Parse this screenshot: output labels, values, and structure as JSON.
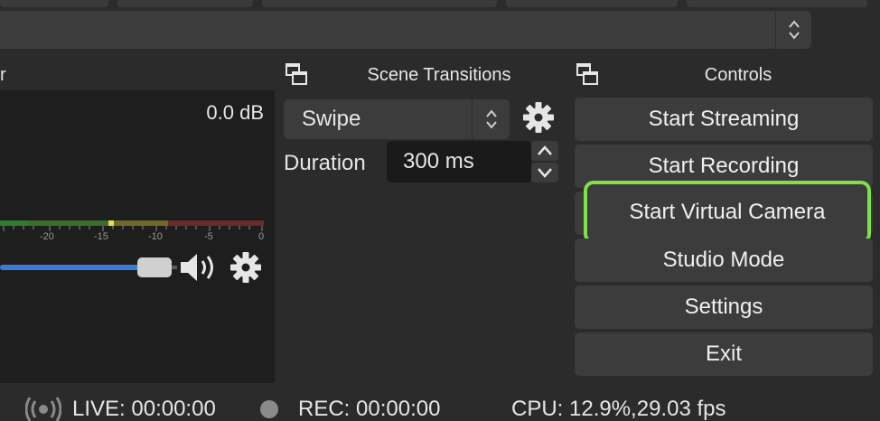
{
  "mixer": {
    "level_label": "0.0 dB",
    "scale_ticks": [
      "-20",
      "-15",
      "-10",
      "-5",
      "0"
    ],
    "volume_fraction": 0.55,
    "header_fragment": "r"
  },
  "transitions": {
    "title": "Scene Transitions",
    "selected": "Swipe",
    "duration_label": "Duration",
    "duration_value": "300 ms"
  },
  "controls": {
    "title": "Controls",
    "buttons": {
      "start_streaming": "Start Streaming",
      "start_recording": "Start Recording",
      "start_virtual_camera": "Start Virtual Camera",
      "studio_mode": "Studio Mode",
      "settings": "Settings",
      "exit": "Exit"
    }
  },
  "status": {
    "live": "LIVE: 00:00:00",
    "rec": "REC: 00:00:00",
    "cpu": "CPU: 12.9%,29.03 fps"
  },
  "colors": {
    "highlight": "#7fe04a",
    "volume": "#3a7bd5",
    "meter_green": "#3a8a3a",
    "meter_yellow": "#8a8a2a",
    "meter_red": "#8a2a2a"
  }
}
